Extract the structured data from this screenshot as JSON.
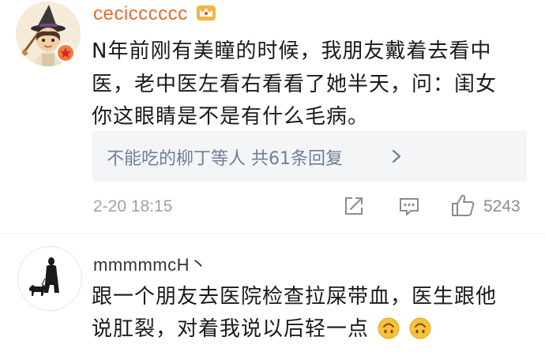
{
  "comments": [
    {
      "username": "cecicccccc",
      "text_lines": [
        "N年前刚有美瞳的时候，我朋友戴着去看中",
        "医，老中医左看右看看了她半天，问：闺女",
        "你这眼睛是不是有什么毛病。"
      ],
      "reply_summary": "不能吃的柳丁等人  共61条回复",
      "timestamp": "2-20 18:15",
      "like_count": "5243"
    },
    {
      "username": "mmmmmcH丶",
      "text_lines": [
        "跟一个朋友去医院检查拉屎带血，医生跟他",
        "说肛裂，对着我说以后轻一点"
      ]
    }
  ],
  "icons": {
    "vip_badge": "red-star-badge-icon",
    "member_badge": "crown-badge-icon",
    "reply_arrow": "chevron-right-icon",
    "share": "share-icon",
    "comment": "comment-icon",
    "like": "thumbs-up-icon",
    "emoji": "upside-down-face-emoji"
  },
  "colors": {
    "username_highlight": "#e86b2a",
    "reply_link": "#6c7f99",
    "meta_gray": "#a2a2a2",
    "reply_box_bg": "#f4f5f7"
  }
}
